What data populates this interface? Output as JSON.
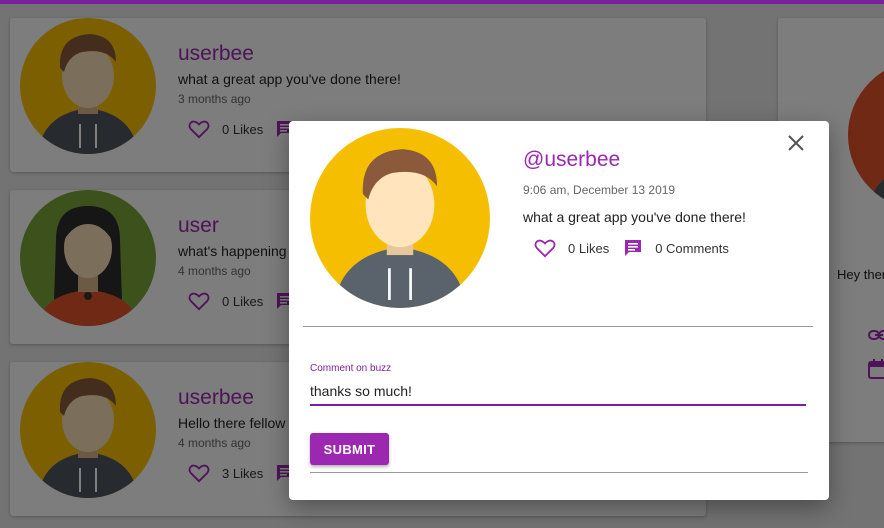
{
  "colors": {
    "accent": "#9c27b0",
    "accent_dark": "#7b1fa2",
    "avatar_yellow": "#f6be00",
    "avatar_green": "#7aa33a",
    "avatar_red": "#e0522b"
  },
  "feed": [
    {
      "username": "userbee",
      "message": "what a great app you've done there!",
      "time": "3 months ago",
      "likes": "0 Likes",
      "avatar": "boy-hoodie-avatar"
    },
    {
      "username": "user",
      "message": "what's happening o",
      "time": "4 months ago",
      "likes": "0 Likes",
      "avatar": "girl-avatar"
    },
    {
      "username": "userbee",
      "message": "Hello there fellow b",
      "time": "4 months ago",
      "likes": "3 Likes",
      "avatar": "boy-hoodie-avatar"
    }
  ],
  "side_card": {
    "message": "Hey ther",
    "link_icon": "link-icon",
    "calendar_icon": "calendar-icon"
  },
  "modal": {
    "handle": "@userbee",
    "timestamp": "9:06 am, December 13 2019",
    "message": "what a great app you've done there!",
    "likes": "0 Likes",
    "comments": "0 Comments",
    "comment_label": "Comment on buzz",
    "comment_value": "thanks so much!",
    "submit_label": "SUBMIT",
    "close_icon": "close-icon"
  }
}
